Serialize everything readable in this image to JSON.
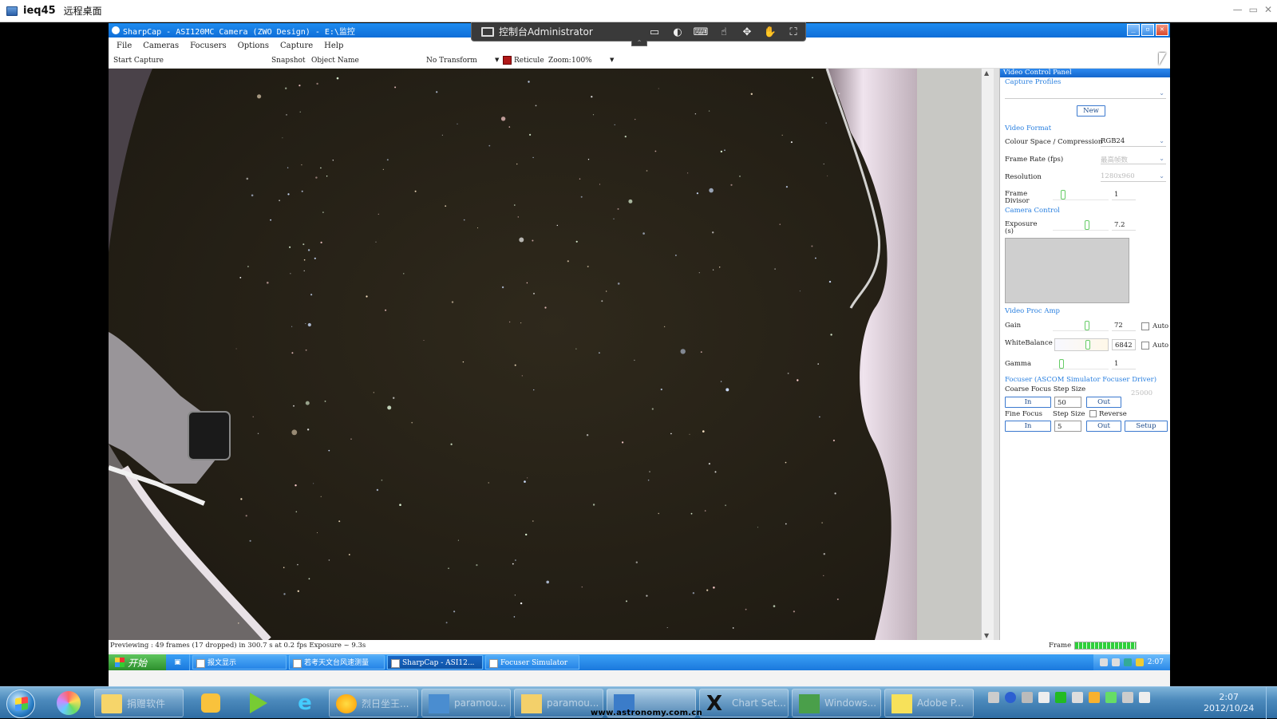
{
  "outer_window": {
    "title": "ieq45",
    "subtitle": "远程桌面",
    "controls": [
      "—",
      "▭",
      "✕"
    ]
  },
  "remote_bar": {
    "title": "控制台Administrator",
    "icons": [
      "monitor-icon",
      "mouse-icon",
      "keyboard-icon",
      "gesture-icon",
      "move-icon",
      "hand-icon",
      "fullscreen-icon"
    ]
  },
  "app": {
    "title": "SharpCap - ASI120MC Camera (ZWO Design) - E:\\监控",
    "menu": [
      "File",
      "Cameras",
      "Focusers",
      "Options",
      "Capture",
      "Help"
    ],
    "toolbar": {
      "start_capture": "Start Capture",
      "snapshot": "Snapshot",
      "object_name": "Object Name",
      "transform": "No Transform",
      "reticule": "Reticule",
      "zoom_label": "Zoom:",
      "zoom_value": "100%"
    },
    "status": {
      "text": "Previewing : 49 frames (17 dropped) in 300.7 s at 0.2 fps Exposure ~ 9.3s",
      "frame_label": "Frame"
    }
  },
  "panel": {
    "header": "Video Control Panel",
    "capture_profiles": "Capture Profiles",
    "new_button": "New",
    "video_format": "Video Format",
    "colour_space_label": "Colour Space / Compression",
    "colour_space_value": "RGB24",
    "frame_rate_label": "Frame Rate (fps)",
    "frame_rate_value": "最高帧数",
    "resolution_label": "Resolution",
    "resolution_value": "1280x960",
    "frame_divisor_label": "Frame Divisor",
    "frame_divisor_value": "1",
    "camera_control": "Camera Control",
    "exposure_label": "Exposure (s)",
    "exposure_value": "7.2",
    "video_proc_amp": "Video Proc Amp",
    "gain_label": "Gain",
    "gain_value": "72",
    "auto_label": "Auto",
    "white_balance_label": "WhiteBalance",
    "white_balance_value": "6842",
    "gamma_label": "Gamma",
    "gamma_value": "1",
    "focuser_header": "Focuser (ASCOM Simulator Focuser Driver)",
    "coarse_label": "Coarse Focus Step Size",
    "coarse_value": "50",
    "position_value": "25000",
    "fine_label": "Fine Focus",
    "fine_step_label": "Step Size",
    "fine_value": "5",
    "reverse_label": "Reverse",
    "in_label": "In",
    "out_label": "Out",
    "setup_label": "Setup"
  },
  "inner_taskbar": {
    "start": "开始",
    "items": [
      "报文显示",
      "若考天文台风速测量",
      "SharpCap - ASI12...",
      "Focuser Simulator"
    ],
    "time": "2:07"
  },
  "outer_taskbar": {
    "items": [
      "捐赠软件",
      "paramou...",
      "paramou...",
      "",
      "Chart Set...",
      "Windows...",
      "Adobe P..."
    ],
    "watermark": "www.astronomy.com.cn",
    "time": "2:07",
    "date": "2012/10/24"
  },
  "colors": {
    "accent": "#1e8cf0",
    "sky": "#2b2518",
    "panel_section": "#2a80e0"
  }
}
